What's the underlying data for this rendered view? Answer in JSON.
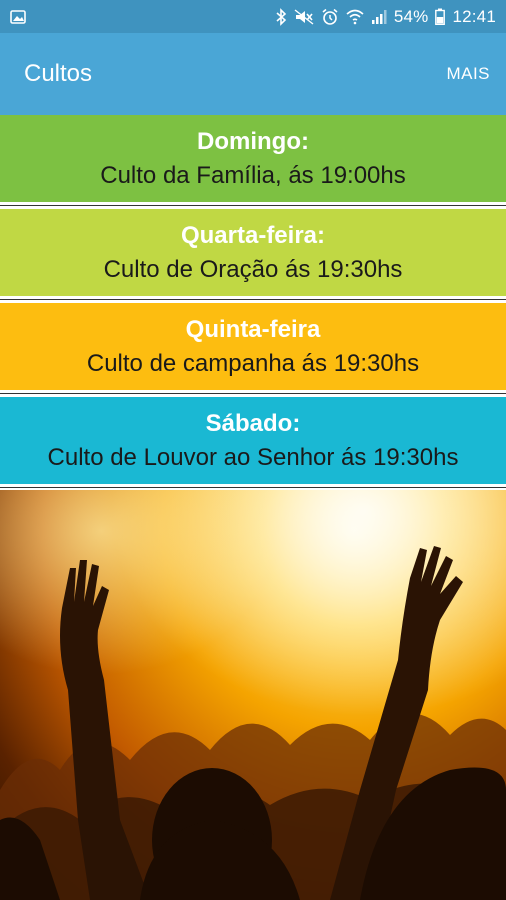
{
  "status_bar": {
    "battery": "54%",
    "time": "12:41",
    "icons": [
      "image-icon",
      "bluetooth-icon",
      "mute-icon",
      "alarm-icon",
      "wifi-icon",
      "signal-icon",
      "battery-icon"
    ]
  },
  "app_bar": {
    "title": "Cultos",
    "action": "MAIS"
  },
  "schedule": [
    {
      "day": "Domingo:",
      "service": "Culto da Família, ás 19:00hs",
      "color": "#7dc142"
    },
    {
      "day": "Quarta-feira:",
      "service": "Culto de Oração ás 19:30hs",
      "color": "#c0d844"
    },
    {
      "day": "Quinta-feira",
      "service": "Culto de campanha ás 19:30hs",
      "color": "#fdbd10"
    },
    {
      "day": "Sábado:",
      "service": "Culto de Louvor ao Senhor ás 19:30hs",
      "color": "#1ab8d3"
    }
  ],
  "colors": {
    "status_bar": "#3f93bf",
    "app_bar": "#4aa6d6"
  }
}
